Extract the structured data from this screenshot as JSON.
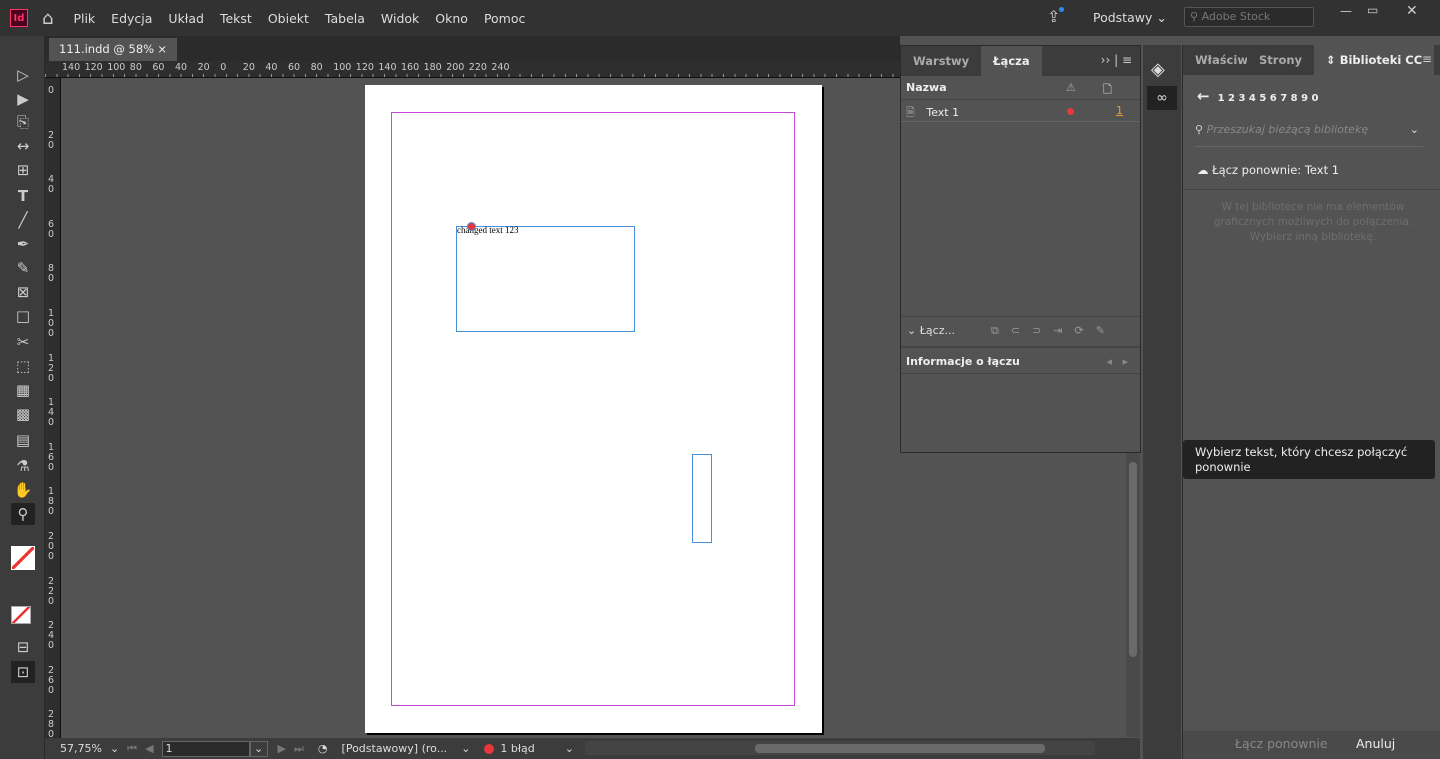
{
  "app": {
    "logo": "Id",
    "menu": [
      "Plik",
      "Edycja",
      "Układ",
      "Tekst",
      "Obiekt",
      "Tabela",
      "Widok",
      "Okno",
      "Pomoc"
    ],
    "workspace": "Podstawy",
    "stock_placeholder": "Adobe Stock"
  },
  "document": {
    "tab": "111.indd @ 58%",
    "close": "×",
    "frame_text": "changed text 123"
  },
  "rulers": {
    "h": [
      "140",
      "120",
      "100",
      "80",
      "60",
      "40",
      "20",
      "0",
      "20",
      "40",
      "60",
      "80",
      "100",
      "120",
      "140",
      "160",
      "180",
      "200",
      "220",
      "240"
    ],
    "v": [
      "0",
      "20",
      "40",
      "60",
      "80",
      "100",
      "120",
      "140",
      "160",
      "180",
      "200",
      "220",
      "240",
      "260",
      "280"
    ]
  },
  "status": {
    "zoom": "57,75%",
    "page": "1",
    "master": "[Podstawowy] (ro...",
    "errors": "1 błąd",
    "error_color": "#e8383d"
  },
  "links_panel": {
    "tabs": [
      "Warstwy",
      "Łącza"
    ],
    "header_name": "Nazwa",
    "rows": [
      {
        "name": "Text 1",
        "page": "1"
      }
    ],
    "section": "Łącz...",
    "info_title": "Informacje o łączu"
  },
  "right_panel": {
    "tabs": [
      "Właściwoś",
      "Strony",
      "Biblioteki CC"
    ],
    "breadcrumb": "1 2 3 4 5 6 7 8 9 0",
    "search_placeholder": "Przeszukaj bieżącą bibliotekę",
    "relink_title": "Łącz ponownie: Text 1",
    "empty_msg": "W tej bibliotece nie ma elementów graficznych możliwych do połączenia. Wybierz inną bibliotekę.",
    "relink_button": "Łącz ponownie",
    "cancel_button": "Anuluj"
  },
  "tooltip": "Wybierz tekst, który chcesz połączyć ponownie"
}
